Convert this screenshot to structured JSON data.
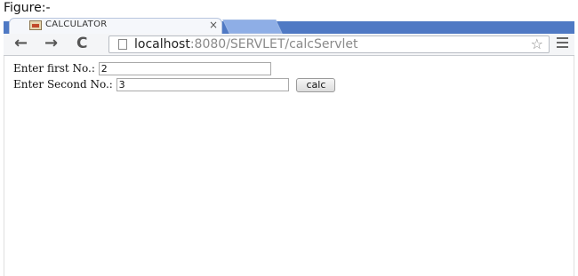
{
  "caption": "Figure:-",
  "browser": {
    "tab_title": "CALCULATOR",
    "tab_close": "×",
    "url_host": "localhost",
    "url_rest": ":8080/SERVLET/calcServlet"
  },
  "icons": {
    "back": "←",
    "forward": "→",
    "reload": "C",
    "star": "☆"
  },
  "form": {
    "first_label": "Enter first No.:",
    "first_value": "2",
    "second_label": "Enter Second No.:",
    "second_value": "3",
    "submit_label": "calc"
  }
}
